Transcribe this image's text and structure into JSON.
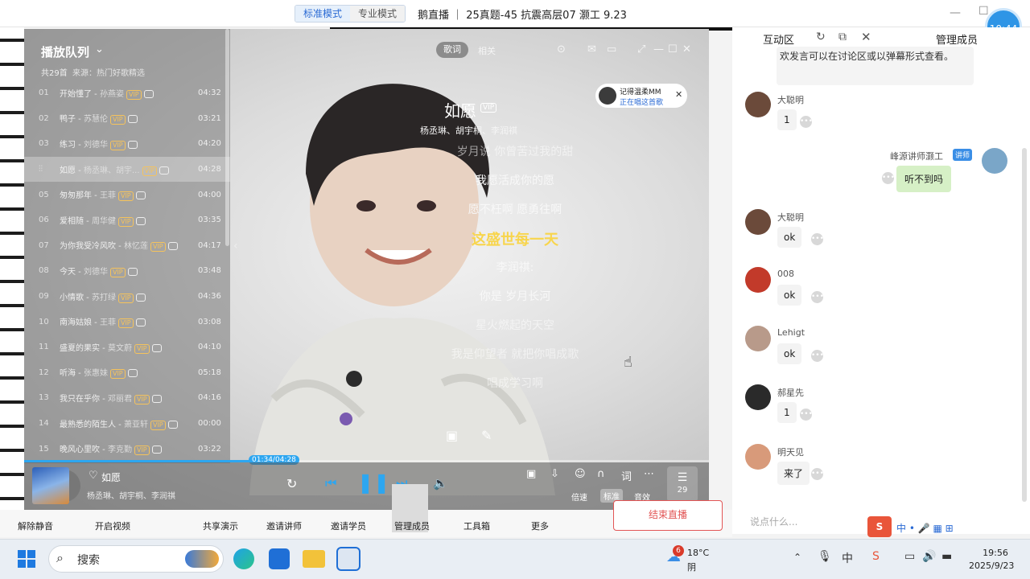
{
  "topbar": {
    "mode_standard": "标准模式",
    "mode_pro": "专业模式",
    "course_title": "鹅直播 ｜ 25真题-45 抗震高层07 灏工 9.23"
  },
  "player": {
    "queue_title": "播放队列",
    "queue_count": "共29首",
    "queue_source": "来源：热门好歌精选",
    "songs": [
      {
        "no": "01",
        "title": "开始懂了",
        "artist": "孙燕姿",
        "dur": "04:32"
      },
      {
        "no": "02",
        "title": "鸭子",
        "artist": "苏慧伦",
        "dur": "03:21"
      },
      {
        "no": "03",
        "title": "练习",
        "artist": "刘德华",
        "dur": "04:20"
      },
      {
        "no": "",
        "title": "如愿",
        "artist": "杨丞琳、胡宇...",
        "dur": "04:28"
      },
      {
        "no": "05",
        "title": "匆匆那年",
        "artist": "王菲",
        "dur": "04:00"
      },
      {
        "no": "06",
        "title": "爱相随",
        "artist": "周华健",
        "dur": "03:35"
      },
      {
        "no": "07",
        "title": "为你我受冷风吹",
        "artist": "林忆莲",
        "dur": "04:17"
      },
      {
        "no": "08",
        "title": "今天",
        "artist": "刘德华",
        "dur": "03:48"
      },
      {
        "no": "09",
        "title": "小情歌",
        "artist": "苏打绿",
        "dur": "04:36"
      },
      {
        "no": "10",
        "title": "南海姑娘",
        "artist": "王菲",
        "dur": "03:08"
      },
      {
        "no": "11",
        "title": "盛夏的果实",
        "artist": "莫文蔚",
        "dur": "04:10"
      },
      {
        "no": "12",
        "title": "听海",
        "artist": "张惠妹",
        "dur": "05:18"
      },
      {
        "no": "13",
        "title": "我只在乎你",
        "artist": "邓丽君",
        "dur": "04:16"
      },
      {
        "no": "14",
        "title": "最熟悉的陌生人",
        "artist": "萧亚轩",
        "dur": "00:00"
      },
      {
        "no": "15",
        "title": "晚风心里吹",
        "artist": "李克勤",
        "dur": "03:22"
      }
    ],
    "current_index": 3,
    "vip": "VIP",
    "tab_lyrics": "歌词",
    "tab_related": "相关",
    "song_name": "如愿",
    "song_artists": "杨丞琳、胡宇桐、李润祺",
    "lyrics": [
      {
        "text": "岁月说 你曾苦过我的甜",
        "style": "faint"
      },
      {
        "text": "我愿活成你的愿",
        "style": "normal"
      },
      {
        "text": "愿不枉啊 愿勇往啊",
        "style": "normal"
      },
      {
        "text": "这盛世每一天",
        "style": "hl"
      },
      {
        "text": "李润祺:",
        "style": "normal"
      },
      {
        "text": "你是 岁月长河",
        "style": "normal"
      },
      {
        "text": "星火燃起的天空",
        "style": "faint"
      },
      {
        "text": "我是仰望者 就把你唱成歌",
        "style": "faint"
      },
      {
        "text": "唱成学习啊",
        "style": "faint"
      }
    ],
    "notice_name": "记得温柔MM",
    "notice_sub": "正在唱这首歌",
    "progress_time": "01:34/04:28",
    "progress": 0.351,
    "now_title": "如愿",
    "now_artist": "杨丞琳、胡宇桐、李润祺",
    "speed": "倍速",
    "quality": "标准",
    "effect": "音效",
    "queue_num": "29"
  },
  "chat": {
    "title": "互动区",
    "manager": "管理成员",
    "top_msg": "欢发言可以在讨论区或以弹幕形式查看。",
    "messages": [
      {
        "name": "大聪明",
        "text": "1",
        "side": "left",
        "color": "#6b4a3a"
      },
      {
        "name": "峰源讲师灏工",
        "text": "听不到吗",
        "side": "right",
        "badge": "讲师",
        "color": "#7aa6c8"
      },
      {
        "name": "大聪明",
        "text": "ok",
        "side": "left",
        "color": "#6b4a3a"
      },
      {
        "name": "008",
        "text": "ok",
        "side": "left",
        "color": "#c23a2a"
      },
      {
        "name": "Lehigt",
        "text": "ok",
        "side": "left",
        "color": "#b89a8a"
      },
      {
        "name": "郝星先",
        "text": "1",
        "side": "left",
        "color": "#2a2a2a"
      },
      {
        "name": "明天见",
        "text": "来了",
        "side": "left",
        "color": "#d89a7a"
      }
    ],
    "input_placeholder": "说点什么...",
    "clock": "10:44"
  },
  "meetbar": {
    "mute": "解除静音",
    "video": "开启视频",
    "share": "共享演示",
    "invite_teacher": "邀请讲师",
    "invite_student": "邀请学员",
    "manage": "管理成员",
    "toolbox": "工具箱",
    "more": "更多",
    "end_live": "结束直播"
  },
  "taskbar": {
    "search": "搜索",
    "weather_badge": "6",
    "temp": "18°C",
    "cond": "阴",
    "time": "19:56",
    "date": "2025/9/23"
  }
}
